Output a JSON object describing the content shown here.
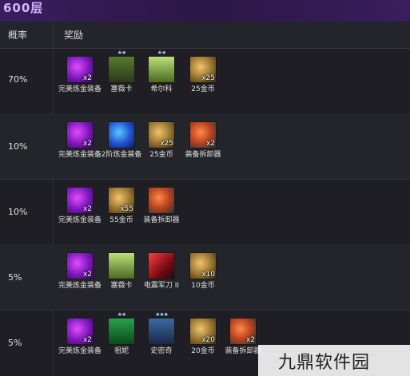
{
  "header": {
    "title": "600层"
  },
  "columns": {
    "probability": "概率",
    "reward": "奖励"
  },
  "rows": [
    {
      "probability": "70%",
      "items": [
        {
          "name": "完美炼金装备",
          "qty": "x2",
          "icon": "purple-orb-icon"
        },
        {
          "name": "塞薇卡",
          "qty": "",
          "icon": "hero-portrait-icon",
          "stars": "★★"
        },
        {
          "name": "希尔科",
          "qty": "",
          "icon": "hero-portrait-icon",
          "stars": "★★"
        },
        {
          "name": "25金币",
          "qty": "x25",
          "icon": "gold-coins-icon"
        }
      ]
    },
    {
      "probability": "10%",
      "items": [
        {
          "name": "完美炼金装备",
          "qty": "x2",
          "icon": "purple-orb-icon"
        },
        {
          "name": "2阶炼金装备",
          "qty": "",
          "icon": "blue-orb-icon"
        },
        {
          "name": "25金币",
          "qty": "x25",
          "icon": "gold-coins-icon"
        },
        {
          "name": "装备拆卸器",
          "qty": "x2",
          "icon": "gear-dismantler-icon"
        }
      ]
    },
    {
      "probability": "10%",
      "items": [
        {
          "name": "完美炼金装备",
          "qty": "x2",
          "icon": "purple-orb-icon"
        },
        {
          "name": "55金币",
          "qty": "x55",
          "icon": "gold-coins-icon"
        },
        {
          "name": "装备拆卸器",
          "qty": "",
          "icon": "gear-dismantler-icon"
        }
      ]
    },
    {
      "probability": "5%",
      "items": [
        {
          "name": "完美炼金装备",
          "qty": "x2",
          "icon": "purple-orb-icon"
        },
        {
          "name": "塞薇卡",
          "qty": "",
          "icon": "hero-portrait-icon"
        },
        {
          "name": "电震军刀 II",
          "qty": "",
          "icon": "saber-icon"
        },
        {
          "name": "10金币",
          "qty": "x10",
          "icon": "gold-coins-icon"
        }
      ]
    },
    {
      "probability": "5%",
      "items": [
        {
          "name": "完美炼金装备",
          "qty": "x2",
          "icon": "purple-orb-icon"
        },
        {
          "name": "祖妮",
          "qty": "",
          "icon": "hero-portrait-icon",
          "stars": "★★"
        },
        {
          "name": "史密奇",
          "qty": "",
          "icon": "hero-portrait-icon",
          "stars": "★★★"
        },
        {
          "name": "20金币",
          "qty": "x20",
          "icon": "gold-coins-icon"
        },
        {
          "name": "装备拆卸器",
          "qty": "x2",
          "icon": "gear-dismantler-icon"
        }
      ]
    }
  ],
  "watermark": "九鼎软件园"
}
